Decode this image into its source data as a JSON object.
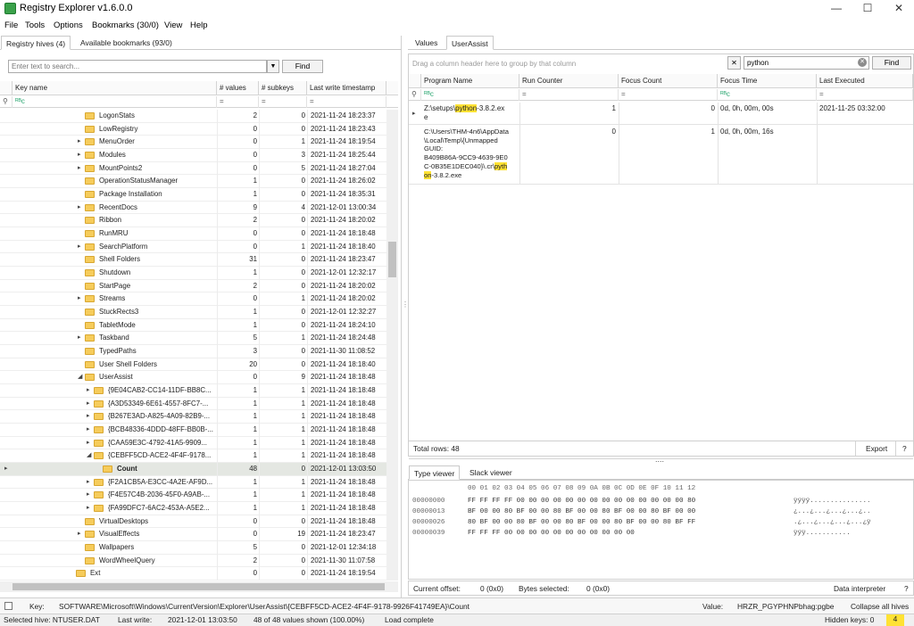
{
  "window": {
    "title": "Registry Explorer v1.6.0.0",
    "min_glyph": "—",
    "max_glyph": "☐",
    "close_glyph": "✕"
  },
  "menu": [
    "File",
    "Tools",
    "Options",
    "Bookmarks (30/0)",
    "View",
    "Help"
  ],
  "left": {
    "tabs": [
      "Registry hives (4)",
      "Available bookmarks (93/0)"
    ],
    "search_placeholder": "Enter text to search...",
    "find_label": "Find",
    "columns": [
      "Key name",
      "# values",
      "# subkeys",
      "Last write timestamp"
    ],
    "filter_glyph": "ᴿᴮc",
    "eq_glyph": "=",
    "rows": [
      {
        "name": "LogonStats",
        "values": "2",
        "subkeys": "0",
        "ts": "2021-11-24 18:23:37",
        "indent": 0,
        "exp": false
      },
      {
        "name": "LowRegistry",
        "values": "0",
        "subkeys": "0",
        "ts": "2021-11-24 18:23:43",
        "indent": 0,
        "exp": false
      },
      {
        "name": "MenuOrder",
        "values": "0",
        "subkeys": "1",
        "ts": "2021-11-24 18:19:54",
        "indent": 0,
        "exp": true
      },
      {
        "name": "Modules",
        "values": "0",
        "subkeys": "3",
        "ts": "2021-11-24 18:25:44",
        "indent": 0,
        "exp": true
      },
      {
        "name": "MountPoints2",
        "values": "0",
        "subkeys": "5",
        "ts": "2021-11-24 18:27:04",
        "indent": 0,
        "exp": true
      },
      {
        "name": "OperationStatusManager",
        "values": "1",
        "subkeys": "0",
        "ts": "2021-11-24 18:26:02",
        "indent": 0,
        "exp": false
      },
      {
        "name": "Package Installation",
        "values": "1",
        "subkeys": "0",
        "ts": "2021-11-24 18:35:31",
        "indent": 0,
        "exp": false
      },
      {
        "name": "RecentDocs",
        "values": "9",
        "subkeys": "4",
        "ts": "2021-12-01 13:00:34",
        "indent": 0,
        "exp": true
      },
      {
        "name": "Ribbon",
        "values": "2",
        "subkeys": "0",
        "ts": "2021-11-24 18:20:02",
        "indent": 0,
        "exp": false
      },
      {
        "name": "RunMRU",
        "values": "0",
        "subkeys": "0",
        "ts": "2021-11-24 18:18:48",
        "indent": 0,
        "exp": false
      },
      {
        "name": "SearchPlatform",
        "values": "0",
        "subkeys": "1",
        "ts": "2021-11-24 18:18:40",
        "indent": 0,
        "exp": true
      },
      {
        "name": "Shell Folders",
        "values": "31",
        "subkeys": "0",
        "ts": "2021-11-24 18:23:47",
        "indent": 0,
        "exp": false
      },
      {
        "name": "Shutdown",
        "values": "1",
        "subkeys": "0",
        "ts": "2021-12-01 12:32:17",
        "indent": 0,
        "exp": false
      },
      {
        "name": "StartPage",
        "values": "2",
        "subkeys": "0",
        "ts": "2021-11-24 18:20:02",
        "indent": 0,
        "exp": false
      },
      {
        "name": "Streams",
        "values": "0",
        "subkeys": "1",
        "ts": "2021-11-24 18:20:02",
        "indent": 0,
        "exp": true
      },
      {
        "name": "StuckRects3",
        "values": "1",
        "subkeys": "0",
        "ts": "2021-12-01 12:32:27",
        "indent": 0,
        "exp": false
      },
      {
        "name": "TabletMode",
        "values": "1",
        "subkeys": "0",
        "ts": "2021-11-24 18:24:10",
        "indent": 0,
        "exp": false
      },
      {
        "name": "Taskband",
        "values": "5",
        "subkeys": "1",
        "ts": "2021-11-24 18:24:48",
        "indent": 0,
        "exp": true
      },
      {
        "name": "TypedPaths",
        "values": "3",
        "subkeys": "0",
        "ts": "2021-11-30 11:08:52",
        "indent": 0,
        "exp": false
      },
      {
        "name": "User Shell Folders",
        "values": "20",
        "subkeys": "0",
        "ts": "2021-11-24 18:18:40",
        "indent": 0,
        "exp": false
      },
      {
        "name": "UserAssist",
        "values": "0",
        "subkeys": "9",
        "ts": "2021-11-24 18:18:48",
        "indent": 0,
        "exp": "open"
      },
      {
        "name": "{9E04CAB2-CC14-11DF-BB8C...",
        "values": "1",
        "subkeys": "1",
        "ts": "2021-11-24 18:18:48",
        "indent": 1,
        "exp": true
      },
      {
        "name": "{A3D53349-6E61-4557-8FC7-...",
        "values": "1",
        "subkeys": "1",
        "ts": "2021-11-24 18:18:48",
        "indent": 1,
        "exp": true
      },
      {
        "name": "{B267E3AD-A825-4A09-82B9-...",
        "values": "1",
        "subkeys": "1",
        "ts": "2021-11-24 18:18:48",
        "indent": 1,
        "exp": true
      },
      {
        "name": "{BCB48336-4DDD-48FF-BB0B-...",
        "values": "1",
        "subkeys": "1",
        "ts": "2021-11-24 18:18:48",
        "indent": 1,
        "exp": true
      },
      {
        "name": "{CAA59E3C-4792-41A5-9909...",
        "values": "1",
        "subkeys": "1",
        "ts": "2021-11-24 18:18:48",
        "indent": 1,
        "exp": true
      },
      {
        "name": "{CEBFF5CD-ACE2-4F4F-9178...",
        "values": "1",
        "subkeys": "1",
        "ts": "2021-11-24 18:18:48",
        "indent": 1,
        "exp": "open"
      },
      {
        "name": "Count",
        "values": "48",
        "subkeys": "0",
        "ts": "2021-12-01 13:03:50",
        "indent": 2,
        "exp": false,
        "sel": true
      },
      {
        "name": "{F2A1CB5A-E3CC-4A2E-AF9D...",
        "values": "1",
        "subkeys": "1",
        "ts": "2021-11-24 18:18:48",
        "indent": 1,
        "exp": true
      },
      {
        "name": "{F4E57C4B-2036-45F0-A9AB-...",
        "values": "1",
        "subkeys": "1",
        "ts": "2021-11-24 18:18:48",
        "indent": 1,
        "exp": true
      },
      {
        "name": "{FA99DFC7-6AC2-453A-A5E2...",
        "values": "1",
        "subkeys": "1",
        "ts": "2021-11-24 18:18:48",
        "indent": 1,
        "exp": true
      },
      {
        "name": "VirtualDesktops",
        "values": "0",
        "subkeys": "0",
        "ts": "2021-11-24 18:18:48",
        "indent": 0,
        "exp": false
      },
      {
        "name": "VisualEffects",
        "values": "0",
        "subkeys": "19",
        "ts": "2021-11-24 18:23:47",
        "indent": 0,
        "exp": true
      },
      {
        "name": "Wallpapers",
        "values": "5",
        "subkeys": "0",
        "ts": "2021-12-01 12:34:18",
        "indent": 0,
        "exp": false
      },
      {
        "name": "WordWheelQuery",
        "values": "2",
        "subkeys": "0",
        "ts": "2021-11-30 11:07:58",
        "indent": 0,
        "exp": false
      },
      {
        "name": "Ext",
        "values": "0",
        "subkeys": "0",
        "ts": "2021-11-24 18:19:54",
        "indent": -1,
        "exp": false
      }
    ]
  },
  "right": {
    "tabs": [
      "Values",
      "UserAssist"
    ],
    "group_hint": "Drag a column header here to group by that column",
    "clear_glyph": "✕",
    "search_value": "python",
    "find_label": "Find",
    "columns": [
      "Program Name",
      "Run Counter",
      "Focus Count",
      "Focus Time",
      "Last Executed"
    ],
    "row1": {
      "pre": "Z:\\setups\\",
      "hl": "python",
      "post": "-3.8.2.ex",
      "wrap": "e",
      "run": "1",
      "focus": "0",
      "time": "0d, 0h, 00m, 00s",
      "last": "2021-11-25 03:32:00"
    },
    "row2": {
      "l1": "C:\\Users\\THM-4n6\\AppData",
      "l2": "\\Local\\Temp\\{Unmapped",
      "l3": "GUID:",
      "l4": "B409B86A-9CC9-4639-9E0",
      "l5_pre": "C-0B35E1DEC040}\\.cr\\",
      "l5_hl": "pyth",
      "l6_hl": "on",
      "l6_post": "-3.8.2.exe",
      "run": "0",
      "focus": "1",
      "time": "0d, 0h, 00m, 16s",
      "last": ""
    },
    "total_rows": "Total rows: 48",
    "export_label": "Export",
    "help_label": "?",
    "dots": "....",
    "bottom_tabs": [
      "Type viewer",
      "Slack viewer"
    ],
    "hex_header": "00 01 02 03 04 05 06 07 08 09 0A 0B 0C 0D 0E 0F 10 11 12",
    "hex_rows": [
      {
        "off": "00000000",
        "bytes": "FF FF FF FF 00 00 00 00 00 00 00 00 00 00 00 00 00 00 80",
        "ascii": "ÿÿÿÿ..............."
      },
      {
        "off": "00000013",
        "bytes": "BF 00 00 80 BF 00 00 80 BF 00 00 80 BF 00 00 80 BF 00 00",
        "ascii": "¿...¿...¿...¿...¿.."
      },
      {
        "off": "00000026",
        "bytes": "80 BF 00 00 80 BF 00 00 80 BF 00 00 80 BF 00 00 80 BF FF",
        "ascii": ".¿...¿...¿...¿...¿ÿ"
      },
      {
        "off": "00000039",
        "bytes": "FF FF FF 00 00 00 00 00 00 00 00 00 00 00",
        "ascii": "ÿÿÿ..........."
      }
    ],
    "current_offset_label": "Current offset:",
    "current_offset": "0 (0x0)",
    "bytes_selected_label": "Bytes selected:",
    "bytes_selected": "0 (0x0)",
    "data_interpreter": "Data interpreter",
    "help2": "?"
  },
  "keybar": {
    "key_label": "Key:",
    "key_path": "SOFTWARE\\Microsoft\\Windows\\CurrentVersion\\Explorer\\UserAssist\\{CEBFF5CD-ACE2-4F4F-9178-9926F41749EA}\\Count",
    "value_label": "Value:",
    "value": "HRZR_PGYPHNPbhag:pgbe",
    "collapse": "Collapse all hives"
  },
  "status": {
    "hive": "Selected hive: NTUSER.DAT",
    "last_write_label": "Last write:",
    "last_write": "2021-12-01 13:03:50",
    "shown": "48 of 48 values shown (100.00%)",
    "load": "Load complete",
    "hidden": "Hidden keys: 0",
    "count": "4"
  },
  "colors": {
    "highlight": "#ffe234",
    "selected_row": "#e4e7e2",
    "folder": "#f6cc5b",
    "app_icon": "#3aa14a"
  }
}
